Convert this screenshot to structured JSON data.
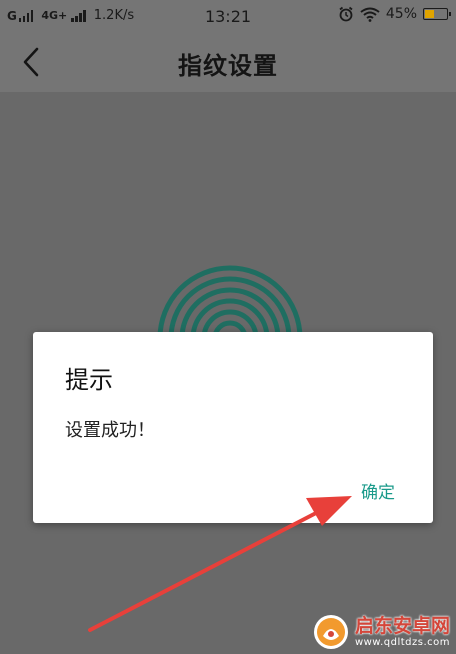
{
  "status_bar": {
    "carrier": "G",
    "network": "4G+",
    "speed": "1.2K/s",
    "time": "13:21",
    "battery": "45%",
    "battery_level": 0.45,
    "battery_color": "#e0a400"
  },
  "header": {
    "title": "指纹设置",
    "back_icon": "chevron-left-icon"
  },
  "content": {
    "fingerprint_icon": "fingerprint-icon",
    "fingerprint_color": "#1f6e61"
  },
  "dialog": {
    "title": "提示",
    "message": "设置成功！",
    "confirm_label": "确定",
    "confirm_color": "#1a9a8a"
  },
  "annotation": {
    "arrow_color": "#e8403a"
  },
  "watermark": {
    "name": "启东安卓网",
    "url": "www.qdltdzs.com"
  }
}
